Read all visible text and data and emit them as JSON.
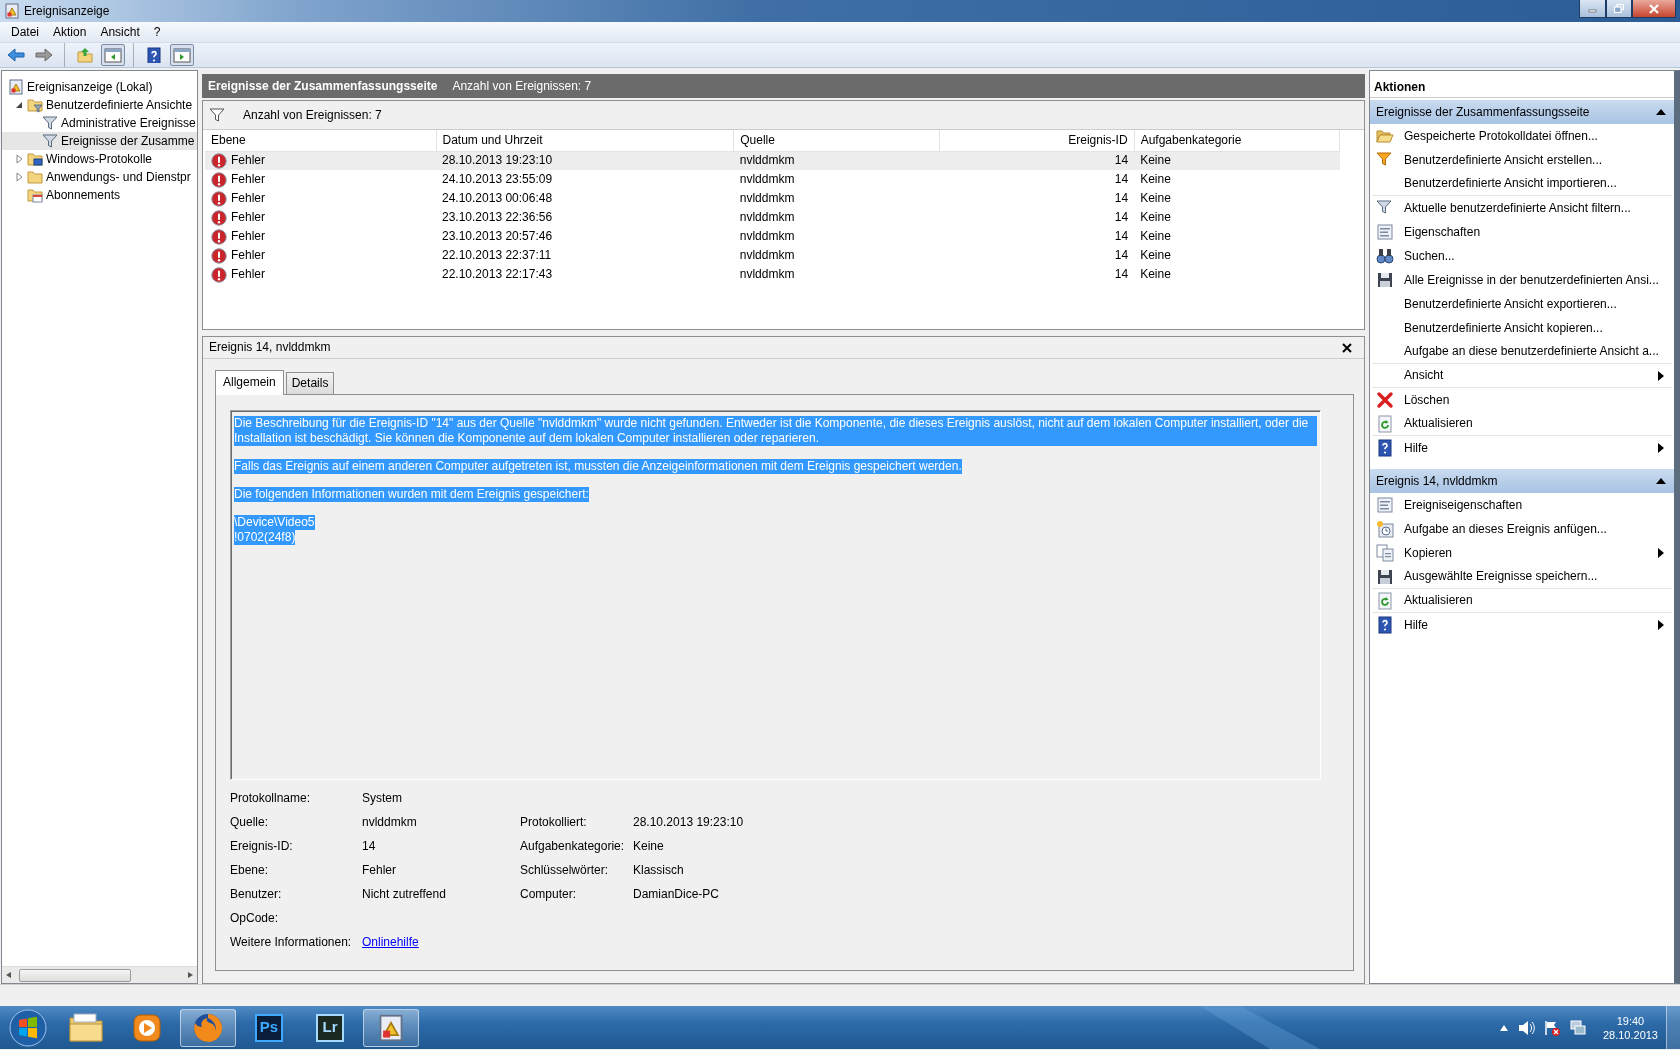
{
  "window": {
    "title": "Ereignisanzeige"
  },
  "menu": [
    "Datei",
    "Aktion",
    "Ansicht",
    "?"
  ],
  "tree": [
    {
      "label": "Ereignisanzeige (Lokal)",
      "selected": false,
      "children": [
        {
          "label": "Benutzerdefinierte Ansichte",
          "selected": false,
          "expanded": true,
          "children": [
            {
              "label": "Administrative Ereignisse",
              "selected": false
            },
            {
              "label": "Ereignisse der Zusamme",
              "selected": true
            }
          ]
        },
        {
          "label": "Windows-Protokolle",
          "selected": false,
          "expanded": false
        },
        {
          "label": "Anwendungs- und Dienstpr",
          "selected": false,
          "expanded": false
        },
        {
          "label": "Abonnements",
          "selected": false
        }
      ]
    }
  ],
  "view": {
    "title": "Ereignisse der Zusammenfassungsseite",
    "count": "Anzahl von Ereignissen: 7",
    "filter_text": "Anzahl von Ereignissen: 7"
  },
  "table": {
    "columns": [
      "Ebene",
      "Datum und Uhrzeit",
      "Quelle",
      "Ereignis-ID",
      "Aufgabenkategorie"
    ],
    "rows": [
      {
        "level": "Fehler",
        "date": "28.10.2013 19:23:10",
        "source": "nvlddmkm",
        "id": "14",
        "category": "Keine",
        "selected": true
      },
      {
        "level": "Fehler",
        "date": "24.10.2013 23:55:09",
        "source": "nvlddmkm",
        "id": "14",
        "category": "Keine",
        "selected": false
      },
      {
        "level": "Fehler",
        "date": "24.10.2013 00:06:48",
        "source": "nvlddmkm",
        "id": "14",
        "category": "Keine",
        "selected": false
      },
      {
        "level": "Fehler",
        "date": "23.10.2013 22:36:56",
        "source": "nvlddmkm",
        "id": "14",
        "category": "Keine",
        "selected": false
      },
      {
        "level": "Fehler",
        "date": "23.10.2013 20:57:46",
        "source": "nvlddmkm",
        "id": "14",
        "category": "Keine",
        "selected": false
      },
      {
        "level": "Fehler",
        "date": "22.10.2013 22:37:11",
        "source": "nvlddmkm",
        "id": "14",
        "category": "Keine",
        "selected": false
      },
      {
        "level": "Fehler",
        "date": "22.10.2013 22:17:43",
        "source": "nvlddmkm",
        "id": "14",
        "category": "Keine",
        "selected": false
      }
    ]
  },
  "detail": {
    "title": "Ereignis 14, nvlddmkm",
    "tabs": [
      {
        "label": "Allgemein",
        "selected": true
      },
      {
        "label": "Details",
        "selected": false
      }
    ],
    "description": {
      "highlighted": true,
      "paragraphs": [
        [
          "Die Beschreibung für die Ereignis-ID \"14\" aus der Quelle \"nvlddmkm\" wurde nicht gefunden. Entweder ist die Komponente, die dieses Ereignis auslöst, nicht auf dem lokalen Computer installiert, oder die Installation ist beschädigt. Sie können die Komponente auf dem lokalen Computer installieren oder reparieren."
        ],
        [
          "Falls das Ereignis auf einem anderen Computer aufgetreten ist, mussten die Anzeigeinformationen mit dem Ereignis gespeichert werden."
        ],
        [
          "Die folgenden Informationen wurden mit dem Ereignis gespeichert: "
        ],
        [
          "\\Device\\Video5",
          "!0702(24f8)"
        ]
      ]
    },
    "fields": [
      [
        {
          "label": "Protokollname:",
          "value": "System"
        }
      ],
      [
        {
          "label": "Quelle:",
          "value": "nvlddmkm"
        },
        {
          "label": "Protokolliert:",
          "value": "28.10.2013 19:23:10"
        }
      ],
      [
        {
          "label": "Ereignis-ID:",
          "value": "14"
        },
        {
          "label": "Aufgabenkategorie:",
          "value": "Keine"
        }
      ],
      [
        {
          "label": "Ebene:",
          "value": "Fehler"
        },
        {
          "label": "Schlüsselwörter:",
          "value": "Klassisch"
        }
      ],
      [
        {
          "label": "Benutzer:",
          "value": "Nicht zutreffend"
        },
        {
          "label": "Computer:",
          "value": "DamianDice-PC"
        }
      ],
      [
        {
          "label": "OpCode:"
        }
      ],
      [
        {
          "label": "Weitere Informationen:",
          "link": "Onlinehilfe"
        }
      ]
    ]
  },
  "actions": {
    "title": "Aktionen",
    "sections": [
      {
        "title": "Ereignisse der Zusammenfassungsseite",
        "expanded": true,
        "items": [
          {
            "label": "Gespeicherte Protokolldatei öffnen...",
            "submenu": false,
            "divider_after": false
          },
          {
            "label": "Benutzerdefinierte Ansicht erstellen...",
            "submenu": false,
            "divider_after": false
          },
          {
            "label": "Benutzerdefinierte Ansicht importieren...",
            "submenu": false,
            "divider_after": true
          },
          {
            "label": "Aktuelle benutzerdefinierte Ansicht filtern...",
            "submenu": false,
            "divider_after": false
          },
          {
            "label": "Eigenschaften",
            "submenu": false,
            "divider_after": false
          },
          {
            "label": "Suchen...",
            "submenu": false,
            "divider_after": false
          },
          {
            "label": "Alle Ereignisse in der benutzerdefinierten Ansi...",
            "submenu": false,
            "divider_after": false
          },
          {
            "label": "Benutzerdefinierte Ansicht exportieren...",
            "submenu": false,
            "divider_after": false
          },
          {
            "label": "Benutzerdefinierte Ansicht kopieren...",
            "submenu": false,
            "divider_after": false
          },
          {
            "label": "Aufgabe an diese benutzerdefinierte Ansicht a...",
            "submenu": false,
            "divider_after": true
          },
          {
            "label": "Ansicht",
            "submenu": true,
            "divider_after": true
          },
          {
            "label": "Löschen",
            "submenu": false,
            "divider_after": false
          },
          {
            "label": "Aktualisieren",
            "submenu": false,
            "divider_after": true
          },
          {
            "label": "Hilfe",
            "submenu": true,
            "divider_after": false
          }
        ]
      },
      {
        "title": "Ereignis 14, nvlddmkm",
        "expanded": true,
        "items": [
          {
            "label": "Ereigniseigenschaften",
            "submenu": false,
            "divider_after": false
          },
          {
            "label": "Aufgabe an dieses Ereignis anfügen...",
            "submenu": false,
            "divider_after": false
          },
          {
            "label": "Kopieren",
            "submenu": true,
            "divider_after": false
          },
          {
            "label": "Ausgewählte Ereignisse speichern...",
            "submenu": false,
            "divider_after": true
          },
          {
            "label": "Aktualisieren",
            "submenu": false,
            "divider_after": true
          },
          {
            "label": "Hilfe",
            "submenu": true,
            "divider_after": false
          }
        ]
      }
    ]
  },
  "taskbar": {
    "apps": [
      {
        "open": false
      },
      {
        "open": false
      },
      {
        "open": true
      },
      {
        "label": "Ps",
        "open": false
      },
      {
        "label": "Lr",
        "open": false
      },
      {
        "open": true
      }
    ],
    "clock": {
      "time": "19:40",
      "date": "28.10.2013"
    }
  }
}
